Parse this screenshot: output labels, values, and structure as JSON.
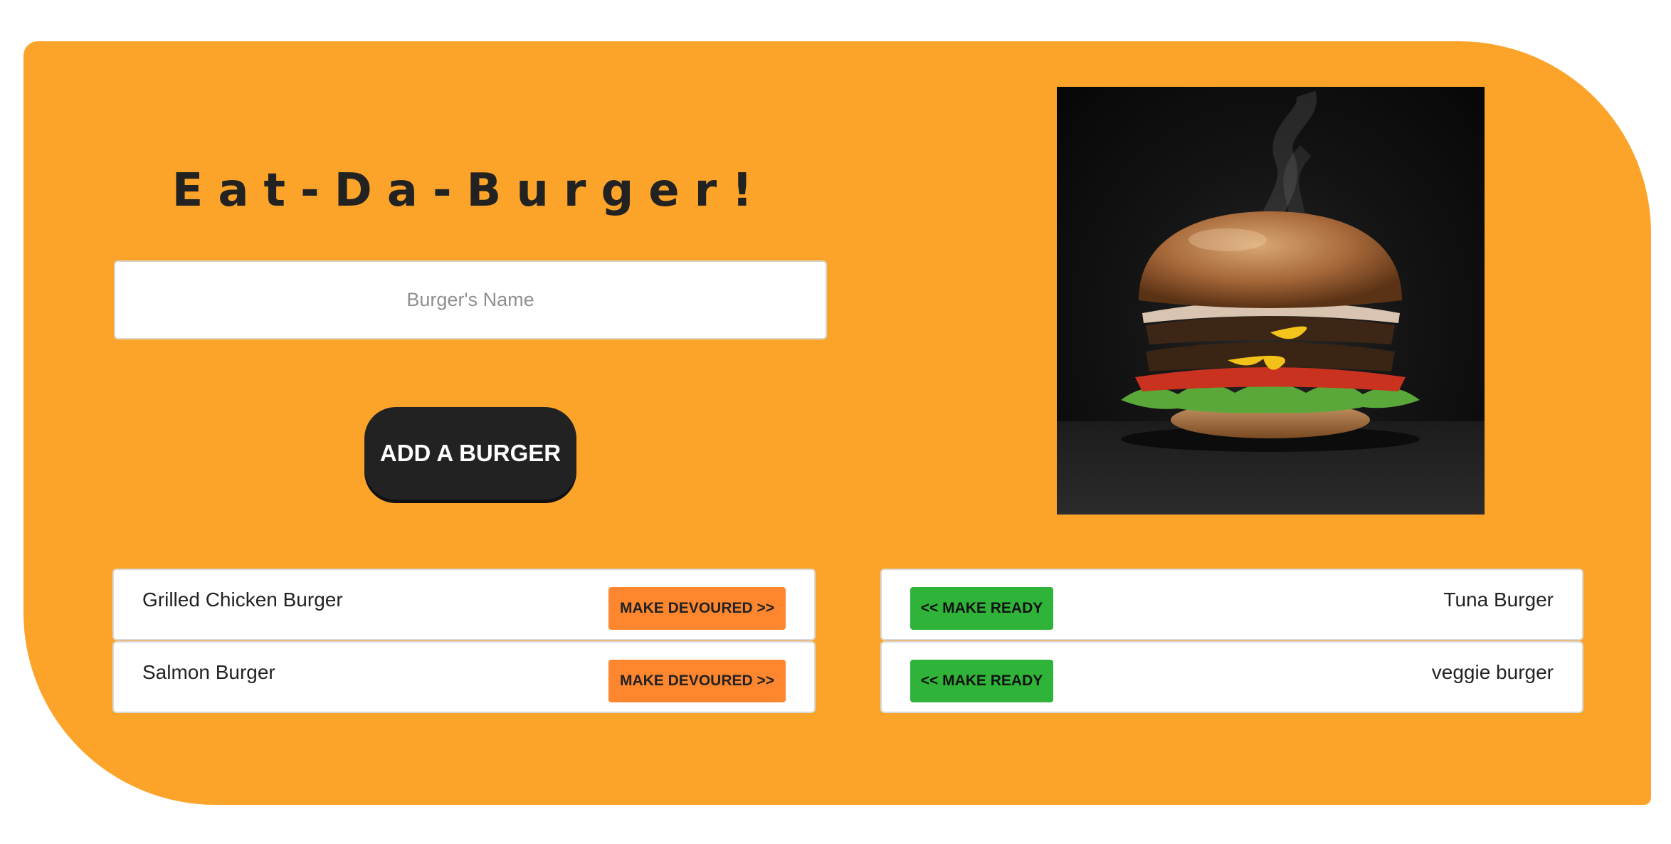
{
  "header": {
    "title": "Eat-Da-Burger!"
  },
  "form": {
    "name_placeholder": "Burger's Name",
    "add_label": "ADD A BURGER"
  },
  "image": {
    "alt": "burger"
  },
  "ready_list": [
    {
      "name": "Grilled Chicken Burger",
      "button": "MAKE DEVOURED >>"
    },
    {
      "name": "Salmon Burger",
      "button": "MAKE DEVOURED >>"
    }
  ],
  "devoured_list": [
    {
      "name": "Tuna Burger",
      "button": "<< MAKE READY"
    },
    {
      "name": "veggie burger",
      "button": "<< MAKE READY"
    }
  ],
  "colors": {
    "panel": "#fca42a",
    "devour_button": "#fd862f",
    "ready_button": "#2fb339",
    "dark": "#222222"
  }
}
